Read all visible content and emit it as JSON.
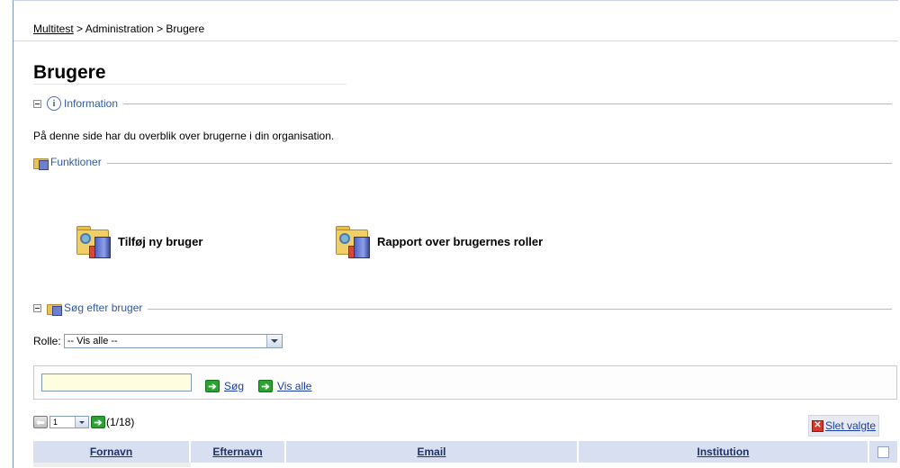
{
  "breadcrumb": {
    "root": "Multitest",
    "sep1": " > ",
    "middle": "Administration",
    "sep2": " > ",
    "current": "Brugere"
  },
  "page": {
    "title": "Brugere",
    "description": "På denne side har du overblik over brugerne i din organisation."
  },
  "sections": {
    "information": "Information",
    "funktioner": "Funktioner",
    "search": "Søg efter bruger"
  },
  "actions": {
    "add_user": "Tilføj ny bruger",
    "report": "Rapport over brugernes roller"
  },
  "filter": {
    "label": "Rolle:",
    "selected": "-- Vis alle --"
  },
  "search": {
    "value": "",
    "search_label": "Søg",
    "show_all_label": "Vis alle"
  },
  "pager": {
    "page": "1",
    "count": "(1/18)"
  },
  "delete_selected": "Slet valgte",
  "grid": {
    "columns": [
      "Fornavn",
      "Efternavn",
      "Email",
      "Institution"
    ]
  },
  "colors": {
    "link": "#1a3ea6",
    "section_header": "#2f5aa0",
    "grid_header_bg": "#d7dff0"
  },
  "icons": {
    "collapse": "collapse-minus-icon",
    "info": "info-icon",
    "functions": "folder-tools-icon",
    "go": "green-arrow-right-icon",
    "prev": "arrow-left-icon",
    "delete": "red-x-icon"
  }
}
